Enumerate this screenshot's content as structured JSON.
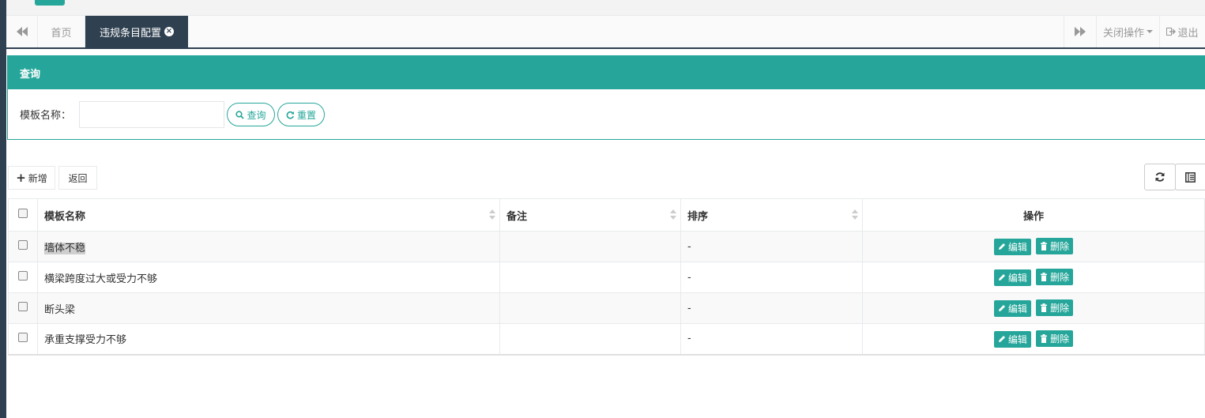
{
  "colors": {
    "accent": "#26a69a",
    "nav_dark": "#2f4050"
  },
  "tabs": {
    "prev_icon": "backward-icon",
    "home_label": "首页",
    "active_label": "违规条目配置",
    "next_icon": "forward-icon",
    "close_ops_label": "关闭操作",
    "exit_label": "退出"
  },
  "query": {
    "panel_title": "查询",
    "template_name_label": "模板名称：",
    "template_name_value": "",
    "search_label": "查询",
    "reset_label": "重置"
  },
  "toolbar": {
    "add_label": "新增",
    "back_label": "返回",
    "refresh_icon": "refresh-icon",
    "columns_icon": "columns-icon"
  },
  "table": {
    "headers": {
      "name": "模板名称",
      "remark": "备注",
      "sort": "排序",
      "ops": "操作"
    },
    "rows": [
      {
        "name": "墙体不稳",
        "remark": "",
        "sort": "-"
      },
      {
        "name": "横梁跨度过大或受力不够",
        "remark": "",
        "sort": "-"
      },
      {
        "name": "断头梁",
        "remark": "",
        "sort": "-"
      },
      {
        "name": "承重支撑受力不够",
        "remark": "",
        "sort": "-"
      }
    ],
    "edit_label": "编辑",
    "delete_label": "删除"
  }
}
